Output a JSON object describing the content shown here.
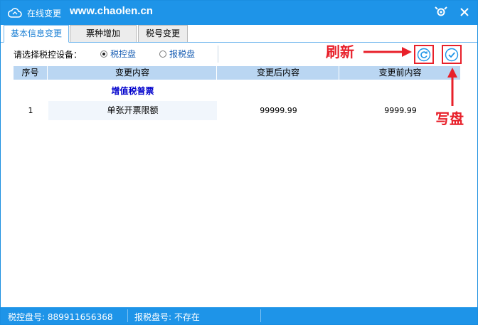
{
  "titlebar": {
    "app_title": "在线变更",
    "url": "www.chaolen.cn"
  },
  "tabs": [
    {
      "label": "基本信息变更",
      "active": true
    },
    {
      "label": "票种增加",
      "active": false
    },
    {
      "label": "税号变更",
      "active": false
    }
  ],
  "device": {
    "label": "请选择税控设备：",
    "options": [
      {
        "label": "税控盘",
        "selected": true
      },
      {
        "label": "报税盘",
        "selected": false
      }
    ]
  },
  "table": {
    "columns": [
      "序号",
      "变更内容",
      "变更后内容",
      "变更前内容"
    ],
    "group_title": "增值税普票",
    "rows": [
      {
        "index": "1",
        "item": "单张开票限额",
        "after": "99999.99",
        "before": "9999.99"
      }
    ]
  },
  "annotations": {
    "refresh": "刷新",
    "write": "写盘"
  },
  "statusbar": {
    "tax_control_disk": "税控盘号: 889911656368",
    "tax_report_disk": "报税盘号: 不存在"
  },
  "colors": {
    "brand_blue": "#1e94e8",
    "header_blue": "#bad6f2",
    "annotation_red": "#e8202a",
    "group_title_blue": "#0000cc"
  }
}
